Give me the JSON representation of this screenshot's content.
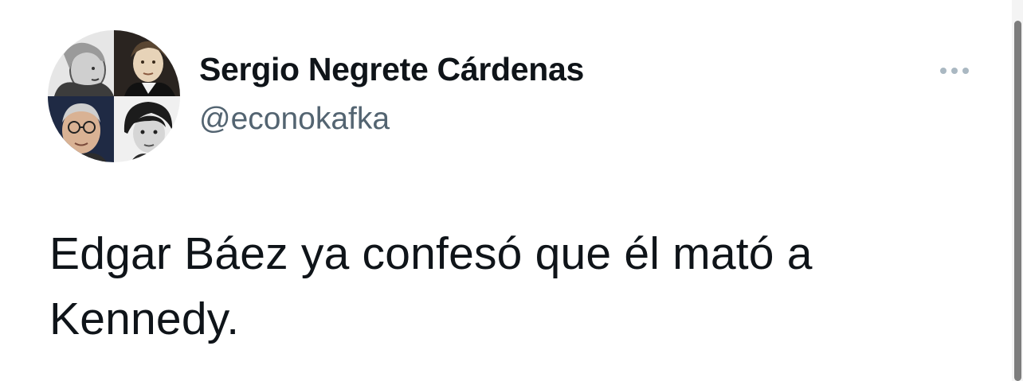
{
  "tweet": {
    "display_name": "Sergio Negrete Cárdenas",
    "handle": "@econokafka",
    "text": "Edgar Báez ya confesó que él mató a Kennedy.",
    "more_icon": "ellipsis-icon"
  },
  "avatar": {
    "icon": "profile-avatar",
    "quadrants": [
      "portrait-top-left",
      "portrait-top-right",
      "portrait-bottom-left",
      "portrait-bottom-right"
    ]
  },
  "colors": {
    "text": "#0f1419",
    "secondary": "#536471",
    "more_dots": "#aab8c2",
    "scroll_thumb": "#7d7d7d"
  }
}
